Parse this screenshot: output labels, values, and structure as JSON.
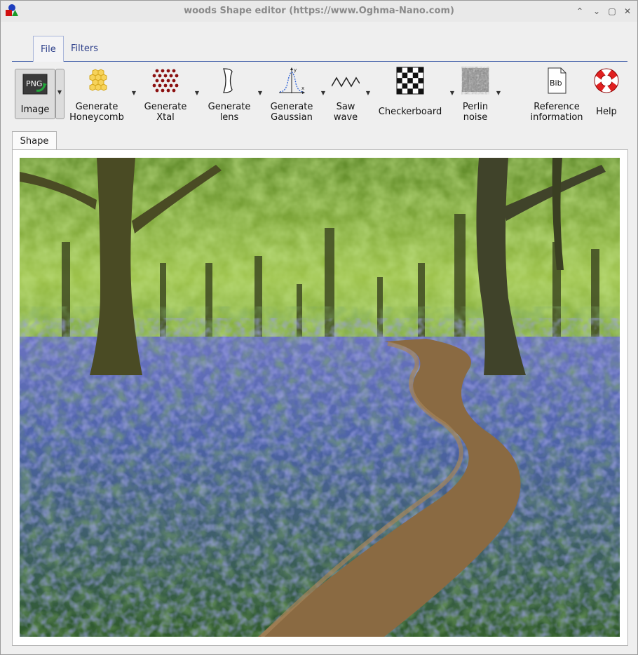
{
  "window": {
    "title": "woods Shape editor (https://www.Oghma-Nano.com)"
  },
  "window_controls": {
    "minimize_glyph": "⌃",
    "restore_glyph": "⌄",
    "maximize_glyph": "▢",
    "close_glyph": "✕"
  },
  "ribbon": {
    "tabs": [
      {
        "label": "File"
      },
      {
        "label": "Filters"
      }
    ]
  },
  "toolbar": {
    "image": {
      "label": "Image",
      "icon_text": "PNG"
    },
    "honeycomb": {
      "label1": "Generate",
      "label2": "Honeycomb"
    },
    "xtal": {
      "label1": "Generate",
      "label2": "Xtal"
    },
    "lens": {
      "label1": "Generate",
      "label2": "lens"
    },
    "gaussian": {
      "label1": "Generate",
      "label2": "Gaussian",
      "axis_y": "y",
      "axis_x": "x"
    },
    "saw": {
      "label1": "Saw",
      "label2": "wave"
    },
    "checkerboard": {
      "label": "Checkerboard"
    },
    "perlin": {
      "label1": "Perlin",
      "label2": "noise"
    },
    "reference": {
      "label1": "Reference",
      "label2": "information",
      "icon_text": "Bib"
    },
    "help": {
      "label": "Help"
    }
  },
  "content_tabs": [
    {
      "label": "Shape"
    }
  ],
  "colors": {
    "accent": "#3f5da8",
    "tab_text": "#2d3f8a",
    "title_text": "#8a8a8a"
  }
}
